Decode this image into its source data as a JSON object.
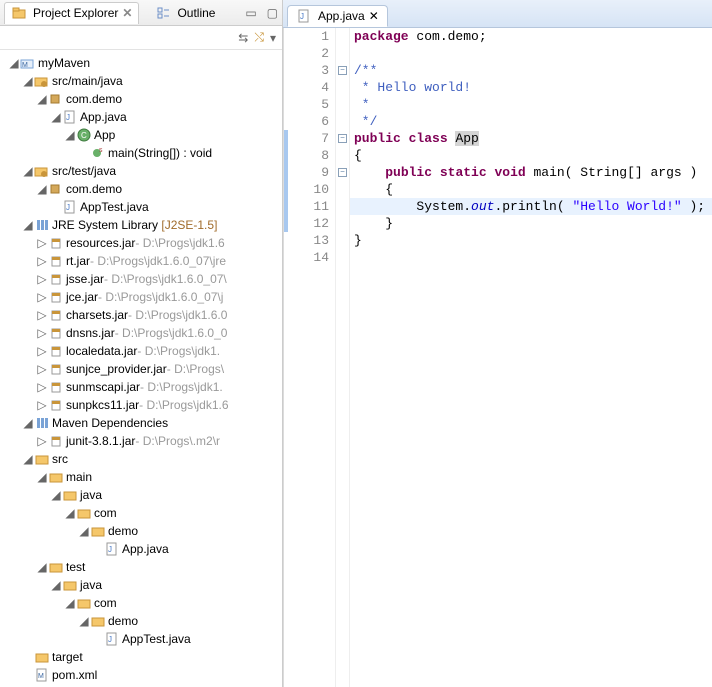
{
  "tabs": {
    "project_explorer": "Project Explorer",
    "outline": "Outline",
    "editor_tab": "App.java"
  },
  "tree": {
    "project": "myMaven",
    "src_main": "src/main/java",
    "pkg": "com.demo",
    "app_java": "App.java",
    "app_class": "App",
    "main_sig": "main(String[]) : void",
    "src_test": "src/test/java",
    "pkg2": "com.demo",
    "apptest": "AppTest.java",
    "jre": "JRE System Library",
    "jre_ver": "[J2SE-1.5]",
    "jars": [
      {
        "n": "resources.jar",
        "p": " - D:\\Progs\\jdk1.6"
      },
      {
        "n": "rt.jar",
        "p": " - D:\\Progs\\jdk1.6.0_07\\jre"
      },
      {
        "n": "jsse.jar",
        "p": " - D:\\Progs\\jdk1.6.0_07\\"
      },
      {
        "n": "jce.jar",
        "p": " - D:\\Progs\\jdk1.6.0_07\\j"
      },
      {
        "n": "charsets.jar",
        "p": " - D:\\Progs\\jdk1.6.0"
      },
      {
        "n": "dnsns.jar",
        "p": " - D:\\Progs\\jdk1.6.0_0"
      },
      {
        "n": "localedata.jar",
        "p": " - D:\\Progs\\jdk1."
      },
      {
        "n": "sunjce_provider.jar",
        "p": " - D:\\Progs\\"
      },
      {
        "n": "sunmscapi.jar",
        "p": " - D:\\Progs\\jdk1."
      },
      {
        "n": "sunpkcs11.jar",
        "p": " - D:\\Progs\\jdk1.6"
      }
    ],
    "maven_dep": "Maven Dependencies",
    "junit": "junit-3.8.1.jar",
    "junit_p": " - D:\\Progs\\.m2\\r",
    "src": "src",
    "main": "main",
    "java": "java",
    "com": "com",
    "demo": "demo",
    "test": "test",
    "target": "target",
    "pom": "pom.xml"
  },
  "code": {
    "l1": {
      "a": "package",
      "b": " com.demo;"
    },
    "l3": "/**",
    "l4": " * Hello world!",
    "l5": " *",
    "l6": " */",
    "l7": {
      "a": "public",
      "b": " ",
      "c": "class",
      "d": " ",
      "e": "App"
    },
    "l8": "{",
    "l9": {
      "a": "    ",
      "b": "public",
      "c": " ",
      "d": "static",
      "e": " ",
      "f": "void",
      "g": " main( String[] args )"
    },
    "l10": "    {",
    "l11": {
      "a": "        System.",
      "b": "out",
      "c": ".println( ",
      "d": "\"Hello World!\"",
      "e": " );"
    },
    "l12": "    }",
    "l13": "}"
  },
  "lines": [
    "1",
    "2",
    "3",
    "4",
    "5",
    "6",
    "7",
    "8",
    "9",
    "10",
    "11",
    "12",
    "13",
    "14"
  ]
}
